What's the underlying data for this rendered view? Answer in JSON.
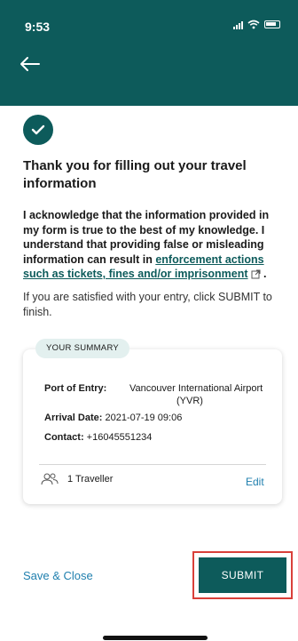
{
  "status_bar": {
    "time": "9:53"
  },
  "header": {
    "back_icon": "back-arrow-icon",
    "bg_color": "#0d5b5b"
  },
  "content": {
    "title": "Thank you for filling out your travel information",
    "ack_text": "I acknowledge that the information provided in my form is true to the best of my knowledge. I understand that providing false or misleading information can result in ",
    "ack_link": "enforcement actions such as tickets, fines and/or imprisonment",
    "ack_end": " .",
    "satisfied": "If you are satisfied with your entry, click SUBMIT to finish."
  },
  "summary": {
    "pill": "YOUR SUMMARY",
    "port_label": "Port of Entry:",
    "port_value_line1": "Vancouver International Airport",
    "port_value_line2": "(YVR)",
    "arrival_label": "Arrival Date:",
    "arrival_value": "2021-07-19 09:06",
    "contact_label": "Contact:",
    "contact_value": "+16045551234",
    "travellers": "1 Traveller",
    "edit": "Edit"
  },
  "footer": {
    "save_close": "Save & Close",
    "submit": "SUBMIT"
  },
  "colors": {
    "brand": "#0d5b5b",
    "link": "#1f7fae",
    "highlight": "#d9403a"
  }
}
